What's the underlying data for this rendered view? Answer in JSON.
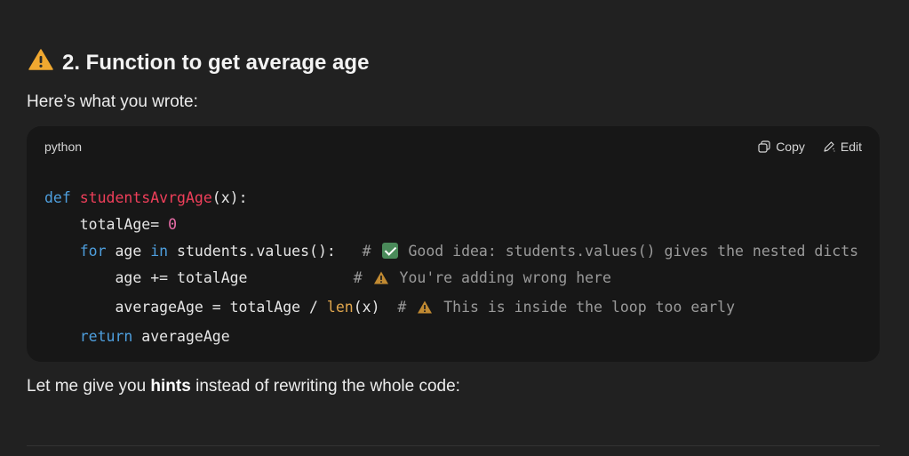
{
  "section": {
    "icon": "warning-icon",
    "title": "2. Function to get average age",
    "intro": "Here’s what you wrote:"
  },
  "code_block": {
    "language": "python",
    "copy_label": "Copy",
    "edit_label": "Edit",
    "lines": {
      "l1_kw": "def",
      "l1_fn": "studentsAvrgAge",
      "l1_rest": "(x):",
      "l2_a": "totalAge= ",
      "l2_num": "0",
      "l3_kw1": "for",
      "l3_a": " age ",
      "l3_kw2": "in",
      "l3_b": " students.values():   ",
      "l3_hash": "# ",
      "l3_comment": " Good idea: students.values() gives the nested dicts",
      "l4_a": "age += totalAge            ",
      "l4_hash": "# ",
      "l4_comment": " You're adding wrong here",
      "l5_a": "averageAge = totalAge / ",
      "l5_bi": "len",
      "l5_b": "(x)  ",
      "l5_hash": "# ",
      "l5_comment": " This is inside the loop too early",
      "l6_kw": "return",
      "l6_a": " averageAge"
    }
  },
  "hint": {
    "before": "Let me give you ",
    "bold": "hints",
    "after": " instead of rewriting the whole code:"
  },
  "colors": {
    "background": "#212121",
    "code_background": "#171717",
    "keyword": "#4e9fde",
    "function_name": "#ef3f5a",
    "number": "#e96da8",
    "builtin": "#e0a64d",
    "comment": "#9a9a9a",
    "warning": "#f0a830",
    "check": "#4a8a5a"
  }
}
